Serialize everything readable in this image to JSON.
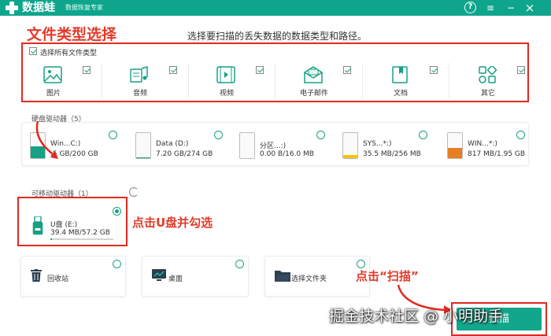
{
  "app": {
    "name": "数据蛙",
    "subtitle": "数据恢复专家"
  },
  "window_controls": {
    "help": "?",
    "menu": "≡",
    "minimize": "−",
    "close": "×"
  },
  "annotations": {
    "file_types_title": "文件类型选择",
    "usb_hint": "点击U盘并勾选",
    "scan_hint": "点击“扫描”"
  },
  "instruction": "选择要扫描的丢失数据的数据类型和路径。",
  "file_types": {
    "select_all_label": "选择所有文件类型",
    "items": [
      {
        "label": "图片",
        "icon": "image-icon",
        "checked": true
      },
      {
        "label": "音频",
        "icon": "audio-icon",
        "checked": true
      },
      {
        "label": "视频",
        "icon": "video-icon",
        "checked": true
      },
      {
        "label": "电子邮件",
        "icon": "email-icon",
        "checked": true
      },
      {
        "label": "文档",
        "icon": "document-icon",
        "checked": true
      },
      {
        "label": "其它",
        "icon": "other-icon",
        "checked": true
      }
    ]
  },
  "hard_drives": {
    "label": "硬盘驱动器（5）",
    "items": [
      {
        "name": "Win...C:)",
        "size": ".5 GB/200 GB",
        "fill": 0.48,
        "color": "#16a085"
      },
      {
        "name": "Data (D:)",
        "size": "7.20 GB/274 GB",
        "fill": 0.03,
        "color": "#16a085"
      },
      {
        "name": "分区...:)",
        "size": "0.00  B/16.0 MB",
        "fill": 0.0,
        "color": "#f39c12"
      },
      {
        "name": "SYS...*:)",
        "size": "35.5 MB/256 MB",
        "fill": 0.14,
        "color": "#f1c40f"
      },
      {
        "name": "WIN...*:)",
        "size": "817 MB/1.95 GB",
        "fill": 0.42,
        "color": "#e67e22"
      }
    ]
  },
  "removable": {
    "label": "可移动驱动器（1）",
    "drive": {
      "name": "U盘 (E:)",
      "size": "39.4 MB/57.2 GB",
      "fill": 0.01
    }
  },
  "locations": [
    {
      "label": "回收站",
      "icon": "recycle-bin-icon"
    },
    {
      "label": "桌面",
      "icon": "desktop-icon"
    },
    {
      "label": "选择文件夹",
      "icon": "folder-icon"
    }
  ],
  "scan_button": "扫描",
  "watermark": "掘金技术社区 @ 小明助手",
  "colors": {
    "brand": "#0fa58c",
    "annotation": "#e23b2a",
    "highlight_box": "#e02a22"
  }
}
